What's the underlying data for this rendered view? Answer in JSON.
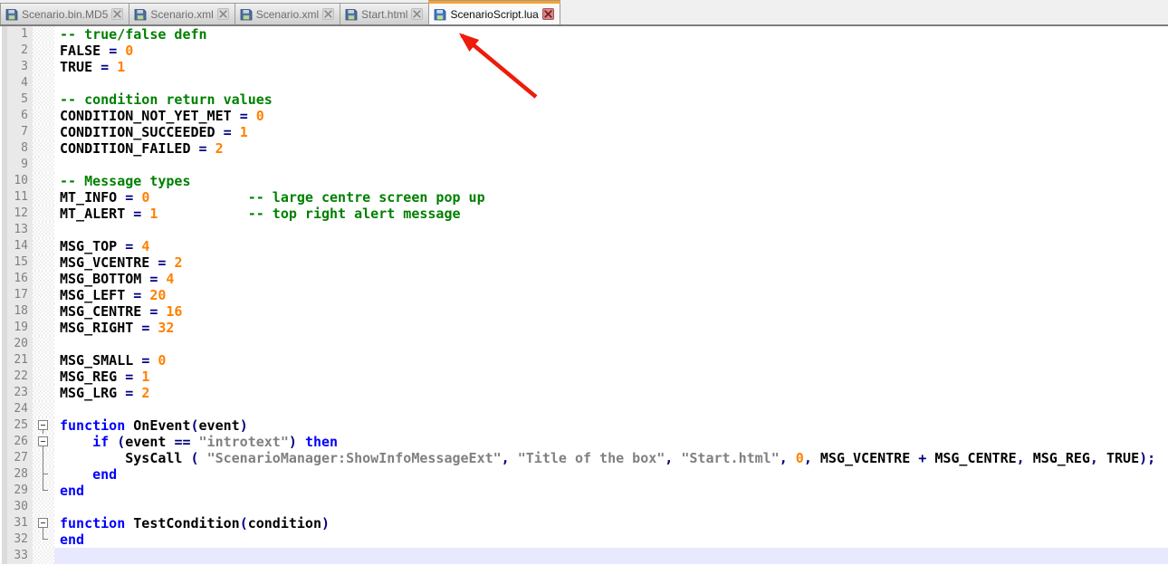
{
  "tabs": [
    {
      "label": "Scenario.bin.MD5",
      "active": false,
      "icon": "saved-floppy-icon",
      "close": "close-icon"
    },
    {
      "label": "Scenario.xml",
      "active": false,
      "icon": "saved-floppy-icon",
      "close": "close-icon"
    },
    {
      "label": "Scenario.xml",
      "active": false,
      "icon": "saved-floppy-icon",
      "close": "close-icon"
    },
    {
      "label": "Start.html",
      "active": false,
      "icon": "saved-floppy-icon",
      "close": "close-icon"
    },
    {
      "label": "ScenarioScript.lua",
      "active": true,
      "icon": "saved-floppy-icon",
      "close": "close-icon"
    }
  ],
  "annotation": {
    "type": "red-arrow",
    "points_to": "ScenarioScript.lua tab"
  },
  "editor": {
    "language": "lua",
    "current_line": 33,
    "lines": [
      {
        "n": 1,
        "fold": "",
        "tokens": [
          [
            "comment",
            "-- true/false defn"
          ]
        ]
      },
      {
        "n": 2,
        "fold": "",
        "tokens": [
          [
            "ident",
            "FALSE "
          ],
          [
            "operator",
            "= "
          ],
          [
            "number",
            "0"
          ]
        ]
      },
      {
        "n": 3,
        "fold": "",
        "tokens": [
          [
            "ident",
            "TRUE "
          ],
          [
            "operator",
            "= "
          ],
          [
            "number",
            "1"
          ]
        ]
      },
      {
        "n": 4,
        "fold": "",
        "tokens": []
      },
      {
        "n": 5,
        "fold": "",
        "tokens": [
          [
            "comment",
            "-- condition return values"
          ]
        ]
      },
      {
        "n": 6,
        "fold": "",
        "tokens": [
          [
            "ident",
            "CONDITION_NOT_YET_MET "
          ],
          [
            "operator",
            "= "
          ],
          [
            "number",
            "0"
          ]
        ]
      },
      {
        "n": 7,
        "fold": "",
        "tokens": [
          [
            "ident",
            "CONDITION_SUCCEEDED "
          ],
          [
            "operator",
            "= "
          ],
          [
            "number",
            "1"
          ]
        ]
      },
      {
        "n": 8,
        "fold": "",
        "tokens": [
          [
            "ident",
            "CONDITION_FAILED "
          ],
          [
            "operator",
            "= "
          ],
          [
            "number",
            "2"
          ]
        ]
      },
      {
        "n": 9,
        "fold": "",
        "tokens": []
      },
      {
        "n": 10,
        "fold": "",
        "tokens": [
          [
            "comment",
            "-- Message types"
          ]
        ]
      },
      {
        "n": 11,
        "fold": "",
        "tokens": [
          [
            "ident",
            "MT_INFO "
          ],
          [
            "operator",
            "= "
          ],
          [
            "number",
            "0"
          ],
          [
            "ident",
            "            "
          ],
          [
            "comment",
            "-- large centre screen pop up"
          ]
        ]
      },
      {
        "n": 12,
        "fold": "",
        "tokens": [
          [
            "ident",
            "MT_ALERT "
          ],
          [
            "operator",
            "= "
          ],
          [
            "number",
            "1"
          ],
          [
            "ident",
            "           "
          ],
          [
            "comment",
            "-- top right alert message"
          ]
        ]
      },
      {
        "n": 13,
        "fold": "",
        "tokens": []
      },
      {
        "n": 14,
        "fold": "",
        "tokens": [
          [
            "ident",
            "MSG_TOP "
          ],
          [
            "operator",
            "= "
          ],
          [
            "number",
            "4"
          ]
        ]
      },
      {
        "n": 15,
        "fold": "",
        "tokens": [
          [
            "ident",
            "MSG_VCENTRE "
          ],
          [
            "operator",
            "= "
          ],
          [
            "number",
            "2"
          ]
        ]
      },
      {
        "n": 16,
        "fold": "",
        "tokens": [
          [
            "ident",
            "MSG_BOTTOM "
          ],
          [
            "operator",
            "= "
          ],
          [
            "number",
            "4"
          ]
        ]
      },
      {
        "n": 17,
        "fold": "",
        "tokens": [
          [
            "ident",
            "MSG_LEFT "
          ],
          [
            "operator",
            "= "
          ],
          [
            "number",
            "20"
          ]
        ]
      },
      {
        "n": 18,
        "fold": "",
        "tokens": [
          [
            "ident",
            "MSG_CENTRE "
          ],
          [
            "operator",
            "= "
          ],
          [
            "number",
            "16"
          ]
        ]
      },
      {
        "n": 19,
        "fold": "",
        "tokens": [
          [
            "ident",
            "MSG_RIGHT "
          ],
          [
            "operator",
            "= "
          ],
          [
            "number",
            "32"
          ]
        ]
      },
      {
        "n": 20,
        "fold": "",
        "tokens": []
      },
      {
        "n": 21,
        "fold": "",
        "tokens": [
          [
            "ident",
            "MSG_SMALL "
          ],
          [
            "operator",
            "= "
          ],
          [
            "number",
            "0"
          ]
        ]
      },
      {
        "n": 22,
        "fold": "",
        "tokens": [
          [
            "ident",
            "MSG_REG "
          ],
          [
            "operator",
            "= "
          ],
          [
            "number",
            "1"
          ]
        ]
      },
      {
        "n": 23,
        "fold": "",
        "tokens": [
          [
            "ident",
            "MSG_LRG "
          ],
          [
            "operator",
            "= "
          ],
          [
            "number",
            "2"
          ]
        ]
      },
      {
        "n": 24,
        "fold": "",
        "tokens": []
      },
      {
        "n": 25,
        "fold": "open",
        "tokens": [
          [
            "keyword",
            "function"
          ],
          [
            "ident",
            " OnEvent"
          ],
          [
            "operator",
            "("
          ],
          [
            "ident",
            "event"
          ],
          [
            "operator",
            ")"
          ]
        ]
      },
      {
        "n": 26,
        "fold": "open",
        "tokens": [
          [
            "ident",
            "    "
          ],
          [
            "keyword",
            "if"
          ],
          [
            "ident",
            " "
          ],
          [
            "operator",
            "("
          ],
          [
            "ident",
            "event "
          ],
          [
            "operator",
            "== "
          ],
          [
            "string",
            "\"introtext\""
          ],
          [
            "operator",
            ")"
          ],
          [
            "ident",
            " "
          ],
          [
            "keyword",
            "then"
          ]
        ]
      },
      {
        "n": 27,
        "fold": "vline",
        "tokens": [
          [
            "ident",
            "        SysCall "
          ],
          [
            "operator",
            "( "
          ],
          [
            "string",
            "\"ScenarioManager:ShowInfoMessageExt\""
          ],
          [
            "operator",
            ", "
          ],
          [
            "string",
            "\"Title of the box\""
          ],
          [
            "operator",
            ", "
          ],
          [
            "string",
            "\"Start.html\""
          ],
          [
            "operator",
            ", "
          ],
          [
            "number",
            "0"
          ],
          [
            "operator",
            ", "
          ],
          [
            "ident",
            "MSG_VCENTRE "
          ],
          [
            "operator",
            "+ "
          ],
          [
            "ident",
            "MSG_CENTRE"
          ],
          [
            "operator",
            ", "
          ],
          [
            "ident",
            "MSG_REG"
          ],
          [
            "operator",
            ", "
          ],
          [
            "ident",
            "TRUE"
          ],
          [
            "operator",
            ");"
          ]
        ]
      },
      {
        "n": 28,
        "fold": "branch",
        "tokens": [
          [
            "ident",
            "    "
          ],
          [
            "keyword",
            "end"
          ]
        ]
      },
      {
        "n": 29,
        "fold": "end",
        "tokens": [
          [
            "keyword",
            "end"
          ]
        ]
      },
      {
        "n": 30,
        "fold": "",
        "tokens": []
      },
      {
        "n": 31,
        "fold": "open",
        "tokens": [
          [
            "keyword",
            "function"
          ],
          [
            "ident",
            " TestCondition"
          ],
          [
            "operator",
            "("
          ],
          [
            "ident",
            "condition"
          ],
          [
            "operator",
            ")"
          ]
        ]
      },
      {
        "n": 32,
        "fold": "end",
        "tokens": [
          [
            "keyword",
            "end"
          ]
        ]
      },
      {
        "n": 33,
        "fold": "",
        "tokens": []
      }
    ]
  },
  "colors": {
    "comment": "#008000",
    "keyword": "#0000FF",
    "number": "#FF8000",
    "string": "#808080",
    "operator": "#000080",
    "ident": "#000000",
    "line_number": "#808080",
    "current_line_bg": "#E8E8FF",
    "active_tab_accent": "#F9A12B",
    "arrow": "#ED1C0C"
  }
}
